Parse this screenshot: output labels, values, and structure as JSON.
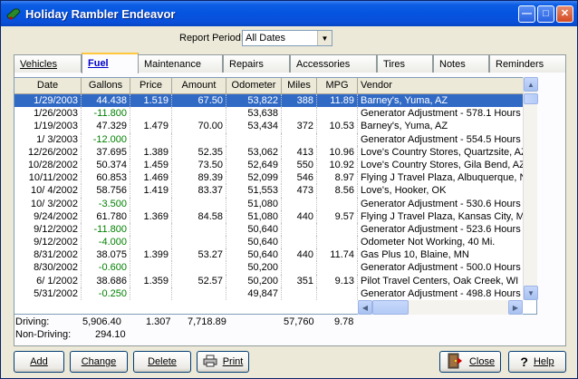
{
  "window": {
    "title": "Holiday Rambler Endeavor"
  },
  "report_period": {
    "label": "Report Period:",
    "value": "All Dates"
  },
  "tabs": [
    {
      "label": "Vehicles",
      "active": false
    },
    {
      "label": "Fuel",
      "active": true
    },
    {
      "label": "Maintenance",
      "active": false
    },
    {
      "label": "Repairs",
      "active": false
    },
    {
      "label": "Accessories",
      "active": false
    },
    {
      "label": "Tires",
      "active": false
    },
    {
      "label": "Notes",
      "active": false
    },
    {
      "label": "Reminders",
      "active": false
    }
  ],
  "grid": {
    "columns": [
      "Date",
      "Gallons",
      "Price",
      "Amount",
      "Odometer",
      "Miles",
      "MPG",
      "Vendor"
    ],
    "rows": [
      [
        "1/29/2003",
        "44.438",
        "1.519",
        "67.50",
        "53,822",
        "388",
        "11.89",
        "Barney's, Yuma, AZ"
      ],
      [
        "1/26/2003",
        "-11.800",
        "",
        "",
        "53,638",
        "",
        "",
        "Generator Adjustment - 578.1 Hours"
      ],
      [
        "1/19/2003",
        "47.329",
        "1.479",
        "70.00",
        "53,434",
        "372",
        "10.53",
        "Barney's, Yuma, AZ"
      ],
      [
        "1/ 3/2003",
        "-12.000",
        "",
        "",
        "",
        "",
        "",
        "Generator Adjustment - 554.5 Hours"
      ],
      [
        "12/26/2002",
        "37.695",
        "1.389",
        "52.35",
        "53,062",
        "413",
        "10.96",
        "Love's Country Stores, Quartzsite, AZ"
      ],
      [
        "10/28/2002",
        "50.374",
        "1.459",
        "73.50",
        "52,649",
        "550",
        "10.92",
        "Love's Country Stores, Gila Bend, AZ"
      ],
      [
        "10/11/2002",
        "60.853",
        "1.469",
        "89.39",
        "52,099",
        "546",
        "8.97",
        "Flying J Travel Plaza, Albuquerque, NM"
      ],
      [
        "10/ 4/2002",
        "58.756",
        "1.419",
        "83.37",
        "51,553",
        "473",
        "8.56",
        "Love's, Hooker, OK"
      ],
      [
        "10/ 3/2002",
        "-3.500",
        "",
        "",
        "51,080",
        "",
        "",
        "Generator Adjustment - 530.6 Hours"
      ],
      [
        "9/24/2002",
        "61.780",
        "1.369",
        "84.58",
        "51,080",
        "440",
        "9.57",
        "Flying J Travel Plaza, Kansas City, MO"
      ],
      [
        "9/12/2002",
        "-11.800",
        "",
        "",
        "50,640",
        "",
        "",
        "Generator Adjustment - 523.6 Hours"
      ],
      [
        "9/12/2002",
        "-4.000",
        "",
        "",
        "50,640",
        "",
        "",
        "Odometer Not Working, 40 Mi."
      ],
      [
        "8/31/2002",
        "38.075",
        "1.399",
        "53.27",
        "50,640",
        "440",
        "11.74",
        "Gas Plus 10, Blaine, MN"
      ],
      [
        "8/30/2002",
        "-0.600",
        "",
        "",
        "50,200",
        "",
        "",
        "Generator Adjustment - 500.0 Hours"
      ],
      [
        "6/ 1/2002",
        "38.686",
        "1.359",
        "52.57",
        "50,200",
        "351",
        "9.13",
        "Pilot Travel Centers, Oak Creek, WI"
      ],
      [
        "5/31/2002",
        "-0.250",
        "",
        "",
        "49,847",
        "",
        "",
        "Generator Adjustment - 498.8 Hours"
      ]
    ]
  },
  "totals": {
    "driving_label": "Driving:",
    "driving_gallons": "5,906.40",
    "driving_price": "1.307",
    "driving_amount": "7,718.89",
    "driving_miles": "57,760",
    "driving_mpg": "9.78",
    "nondriving_label": "Non-Driving:",
    "nondriving_gallons": "294.10"
  },
  "buttons": {
    "add": "Add",
    "change": "Change",
    "delete": "Delete",
    "print": "Print",
    "close": "Close",
    "help": "Help"
  }
}
